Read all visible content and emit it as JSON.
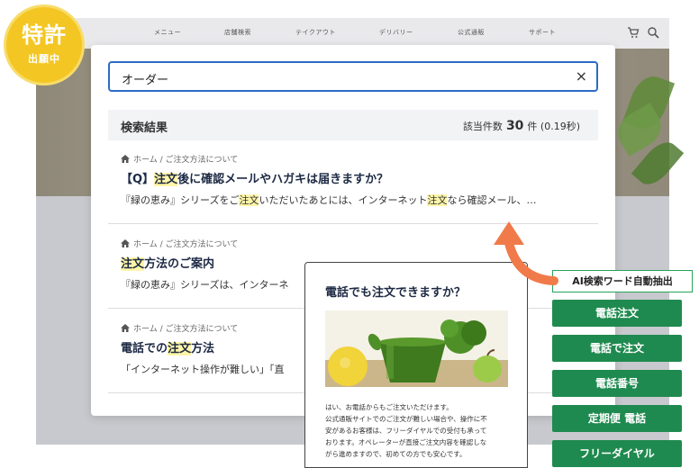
{
  "badge": {
    "main": "特許",
    "sub": "出願中"
  },
  "nav": {
    "items": [
      "メニュー",
      "店舗検索",
      "テイクアウト",
      "デリバリー",
      "公式通販",
      "サポート"
    ],
    "cart_icon": "cart-icon",
    "search_icon": "search-icon"
  },
  "search": {
    "value": "オーダー",
    "clear": "×"
  },
  "results_header": {
    "title": "検索結果",
    "count_label": "該当件数",
    "count": "30",
    "count_unit": "件",
    "time": "(0.19秒)"
  },
  "results": [
    {
      "breadcrumb": "ホーム / ご注文方法について",
      "title_parts": [
        "【Q】",
        "注文",
        "後に確認メールやハガキは届きますか？"
      ],
      "snippet_parts": [
        "『緑の恵み』シリーズをご",
        "注文",
        "いただいたあとには、インターネット",
        "注文",
        "なら確認メール、…"
      ]
    },
    {
      "breadcrumb": "ホーム / ご注文方法について",
      "title_parts": [
        "",
        "注文",
        "方法のご案内"
      ],
      "snippet_parts": [
        "『緑の恵み』シリーズは、インターネ"
      ]
    },
    {
      "breadcrumb": "ホーム / ご注文方法について",
      "title_parts": [
        "電話での",
        "注文",
        "方法"
      ],
      "snippet_parts": [
        "「インターネット操作が難しい」「直"
      ]
    }
  ],
  "preview": {
    "title": "電話でも注文できますか？",
    "lines": [
      "はい、お電話からもご注文いただけます。",
      "公式通販サイトでのご注文が難しい場合や、操作に不",
      "安があるお客様は、フリーダイヤルでの受付も承って",
      "おります。オペレーターが直接ご注文内容を確認しな",
      "がら進めますので、初めての方でも安心です。"
    ]
  },
  "ai": {
    "label": "AI検索ワード自動抽出",
    "keywords": [
      "電話注文",
      "電話で注文",
      "電話番号",
      "定期便 電話",
      "フリーダイヤル"
    ]
  },
  "colors": {
    "accent_blue": "#2b6cc4",
    "highlight": "#fff6a8",
    "keyword_green": "#1f8a4f",
    "arrow_orange": "#f07a4a",
    "badge_yellow": "#f3c623"
  }
}
